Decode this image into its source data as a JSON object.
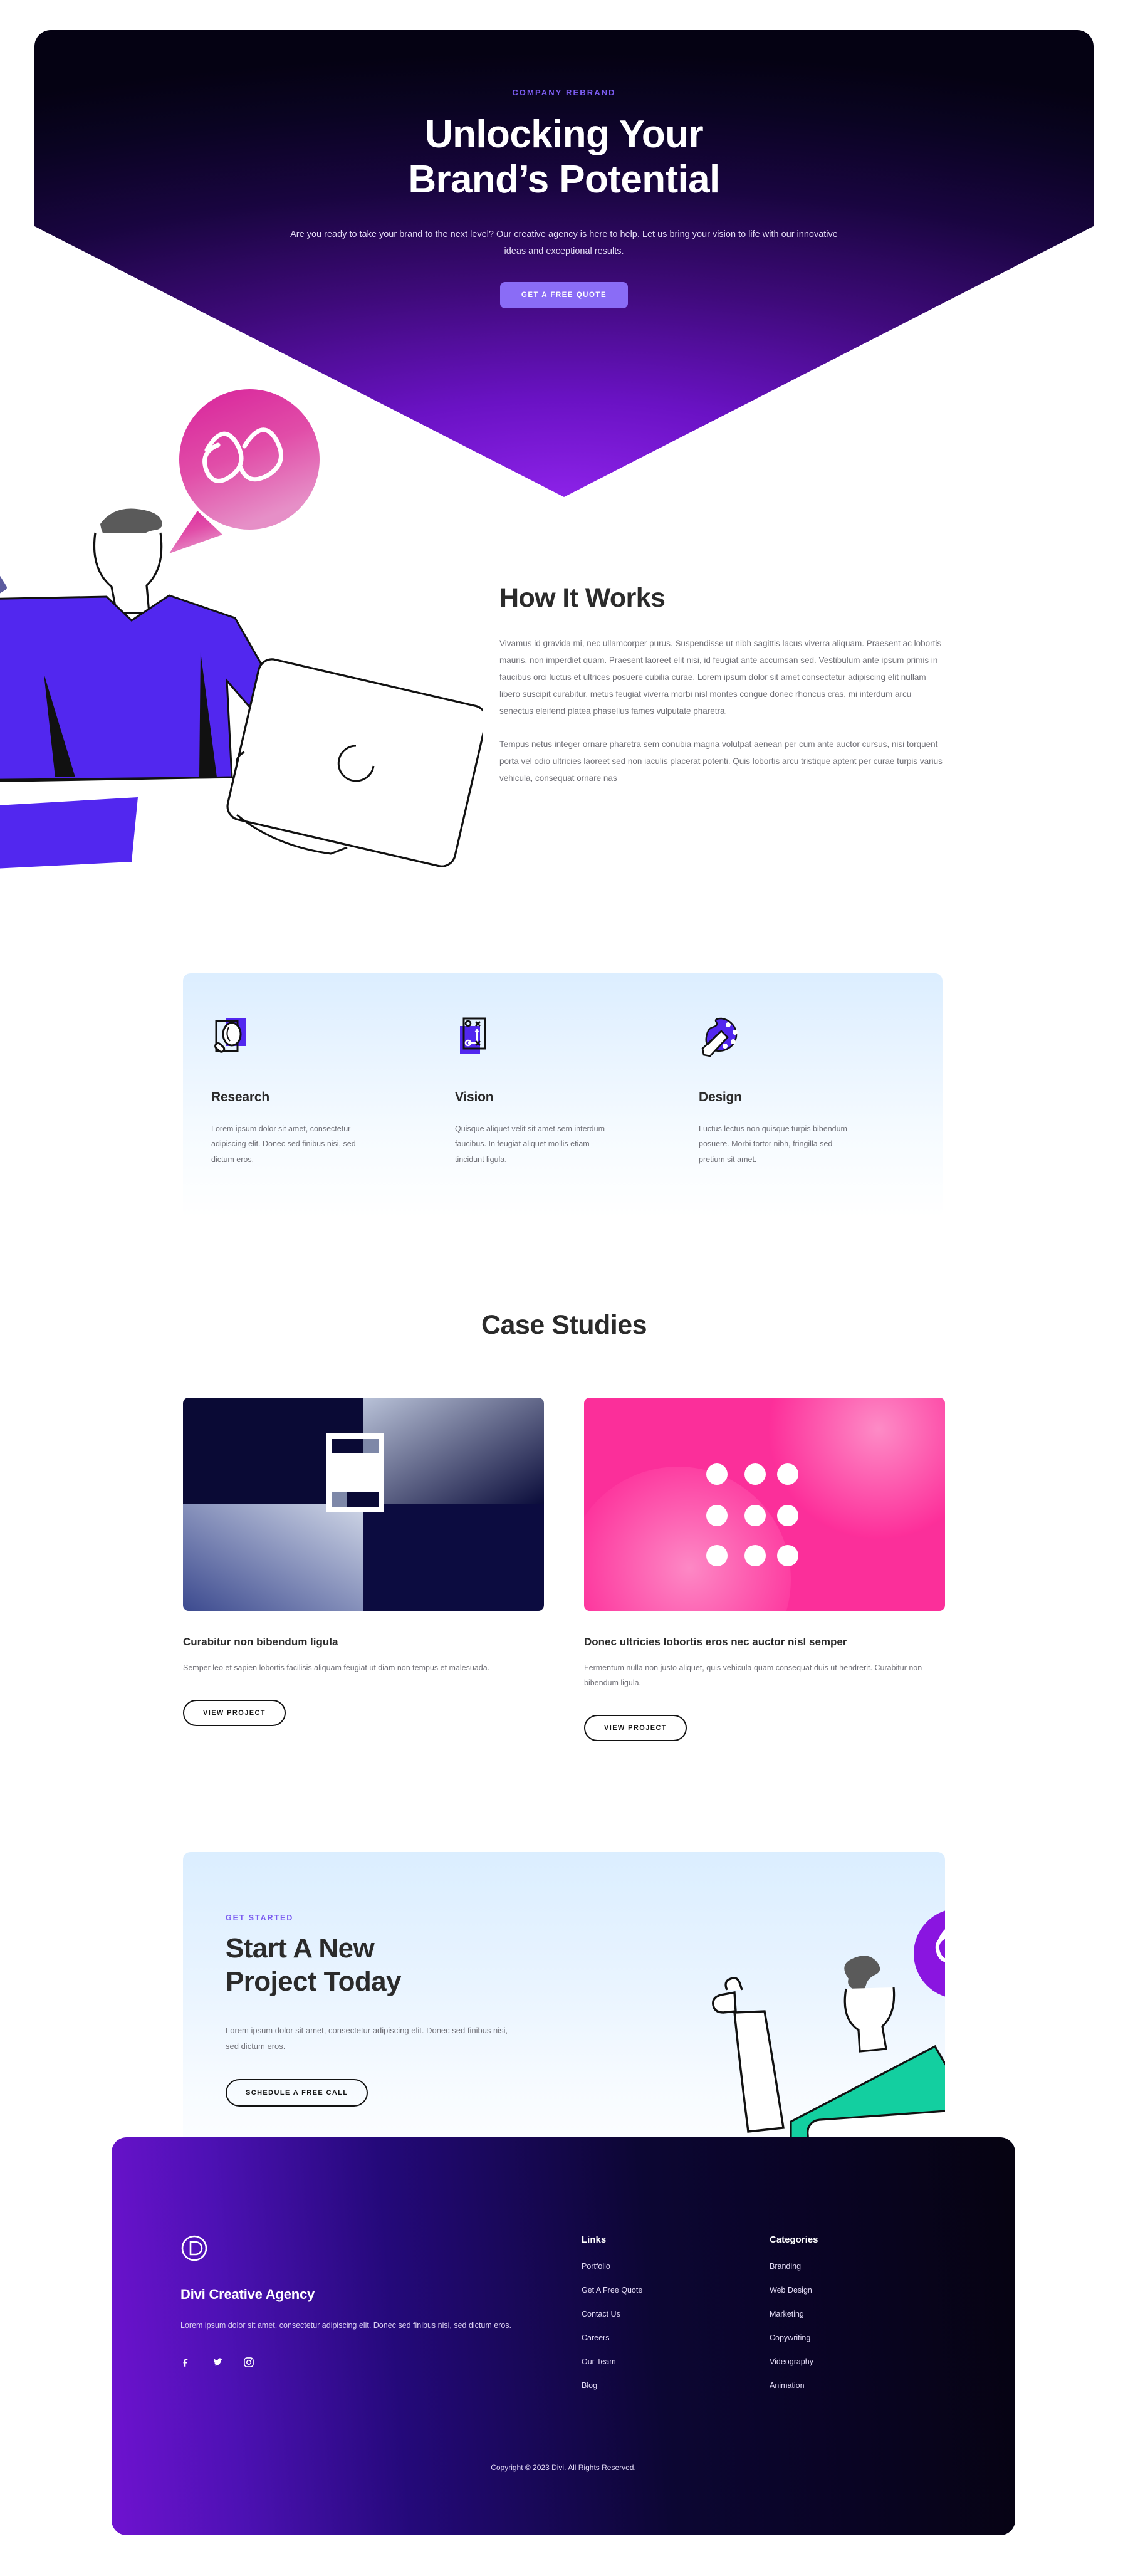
{
  "hero": {
    "eyebrow": "COMPANY REBRAND",
    "title_line1": "Unlocking Your",
    "title_line2": "Brand’s Potential",
    "subtitle": "Are you ready to take your brand to the next level? Our creative agency is here to help. Let us bring your vision to life with our innovative ideas and exceptional results.",
    "cta_label": "GET A FREE QUOTE",
    "accent_color": "#7b5cf0",
    "button_color": "#8a6cf6"
  },
  "how_it_works": {
    "title": "How It Works",
    "paragraph1": "Vivamus id gravida mi, nec ullamcorper purus. Suspendisse ut nibh sagittis lacus viverra aliquam. Praesent ac lobortis mauris, non imperdiet quam. Praesent laoreet elit nisi, id feugiat ante accumsan sed. Vestibulum ante ipsum primis in faucibus orci luctus et ultrices posuere cubilia curae. Lorem ipsum dolor sit amet consectetur adipiscing elit nullam libero suscipit curabitur, metus feugiat viverra morbi nisl montes congue donec rhoncus cras, mi interdum arcu senectus eleifend platea phasellus fames vulputate pharetra.",
    "paragraph2": "Tempus netus integer ornare pharetra sem conubia magna volutpat aenean per cum ante auctor cursus, nisi torquent porta vel odio ultricies laoreet sed non iaculis placerat potenti. Quis lobortis arcu tristique aptent per curae turpis varius vehicula, consequat ornare nas"
  },
  "features": [
    {
      "icon": "magnifier-document-icon",
      "title": "Research",
      "text": "Lorem ipsum dolor sit amet, consectetur adipiscing elit. Donec sed finibus nisi, sed dictum eros."
    },
    {
      "icon": "strategy-board-icon",
      "title": "Vision",
      "text": "Quisque aliquet velit sit amet sem interdum faucibus. In feugiat aliquet mollis etiam tincidunt ligula."
    },
    {
      "icon": "paint-palette-icon",
      "title": "Design",
      "text": "Luctus lectus non quisque turpis bibendum posuere. Morbi tortor nibh, fringilla sed pretium sit amet."
    }
  ],
  "case_studies": {
    "title": "Case Studies",
    "items": [
      {
        "thumb": "dark-navy-grid-thumbnail",
        "title": "Curabitur non bibendum ligula",
        "text": "Semper leo et sapien lobortis facilisis aliquam feugiat ut diam non tempus et malesuada.",
        "button": "VIEW PROJECT"
      },
      {
        "thumb": "pink-dot-grid-thumbnail",
        "title": "Donec ultricies lobortis eros nec auctor nisl semper",
        "text": "Fermentum nulla non justo aliquet, quis vehicula quam consequat duis ut hendrerit. Curabitur non bibendum ligula.",
        "button": "VIEW PROJECT"
      }
    ]
  },
  "cta": {
    "eyebrow": "GET STARTED",
    "title_line1": "Start A New",
    "title_line2": "Project Today",
    "text": "Lorem ipsum dolor sit amet, consectetur adipiscing elit. Donec sed finibus nisi, sed dictum eros.",
    "button": "SCHEDULE A FREE CALL"
  },
  "footer": {
    "logo": "divi-logo-icon",
    "brand_name": "Divi Creative Agency",
    "brand_text": "Lorem ipsum dolor sit amet, consectetur adipiscing elit. Donec sed finibus nisi, sed dictum eros.",
    "socials": [
      {
        "name": "facebook-icon"
      },
      {
        "name": "twitter-icon"
      },
      {
        "name": "instagram-icon"
      }
    ],
    "links_heading": "Links",
    "links": [
      "Portfolio",
      "Get A Free Quote",
      "Contact Us",
      "Careers",
      "Our Team",
      "Blog"
    ],
    "categories_heading": "Categories",
    "categories": [
      "Branding",
      "Web Design",
      "Marketing",
      "Copywriting",
      "Videography",
      "Animation"
    ],
    "copyright": "Copyright © 2023 Divi. All Rights Reserved."
  }
}
